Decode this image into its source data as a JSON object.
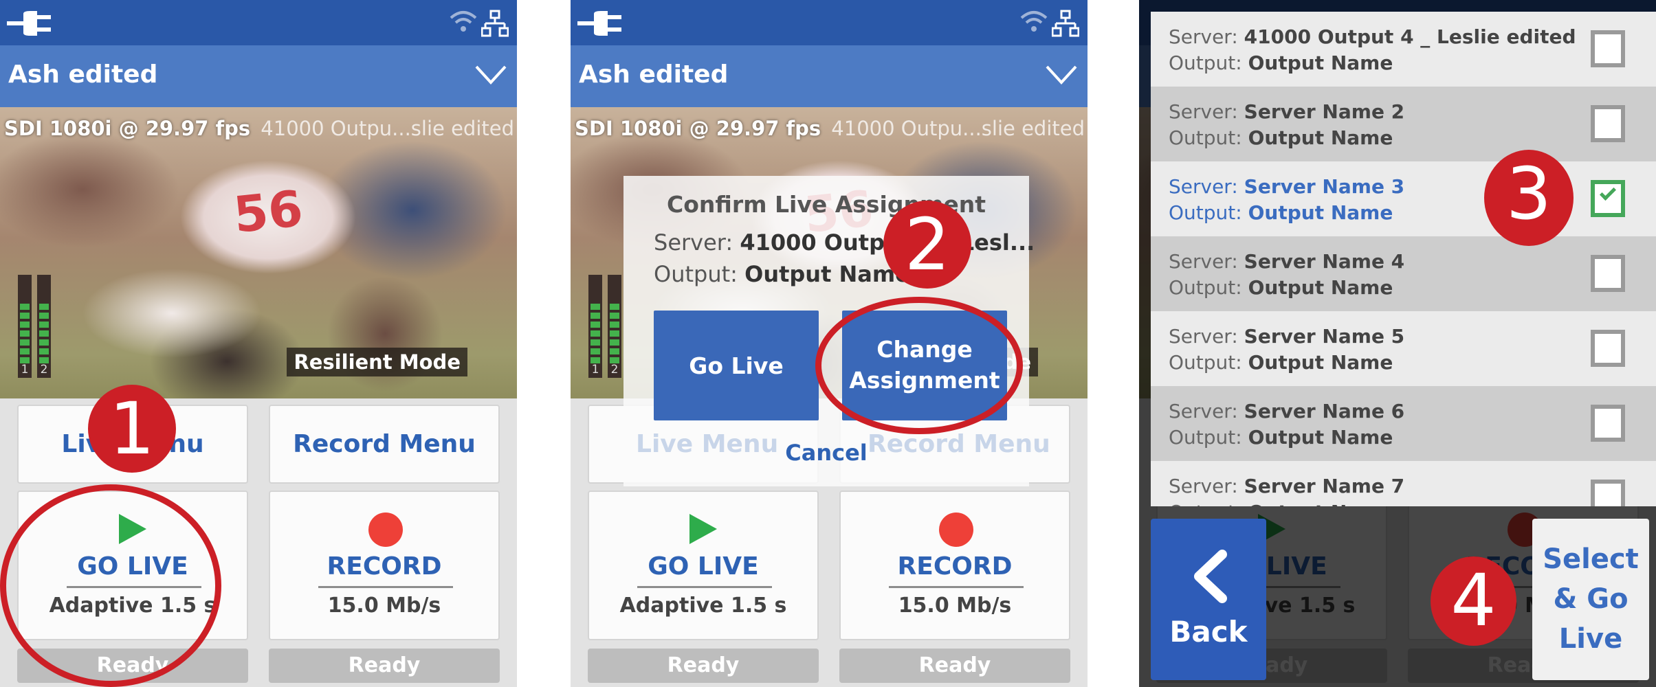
{
  "device": {
    "title": "Ash edited",
    "video_format": "SDI 1080i @ 29.97 fps",
    "server_short": "41000 Outpu...slie edited",
    "mode_badge": "Resilient Mode",
    "audio_channels": [
      "1",
      "2"
    ],
    "audio_level_segments": 7
  },
  "icons": {
    "power": "plug-icon",
    "wifi": "wifi-icon",
    "network": "network-icon",
    "expand": "chevron-down-icon",
    "go_live": "play-icon",
    "record": "record-dot-icon",
    "back": "chevron-left-icon",
    "check": "check-icon"
  },
  "controls": {
    "live_menu": "Live Menu",
    "record_menu": "Record Menu",
    "go_live": {
      "title": "GO LIVE",
      "subtitle": "Adaptive 1.5 s",
      "status": "Ready"
    },
    "record": {
      "title": "RECORD",
      "subtitle": "15.0 Mb/s",
      "status": "Ready"
    }
  },
  "steps": [
    "1",
    "2",
    "3",
    "4"
  ],
  "dialog": {
    "title": "Confirm Live Assignment",
    "server_label": "Server:",
    "server_value": "41000 Output 4 _ Lesl...",
    "output_label": "Output:",
    "output_value": "Output Name",
    "go_live": "Go Live",
    "change_assignment": "Change Assignment",
    "cancel": "Cancel"
  },
  "server_list": {
    "server_label": "Server:",
    "output_label": "Output:",
    "items": [
      {
        "server": "41000 Output 4 _ Leslie edited",
        "output": "Output Name",
        "checked": false
      },
      {
        "server": "Server Name 2",
        "output": "Output Name",
        "checked": false
      },
      {
        "server": "Server Name 3",
        "output": "Output Name",
        "checked": true
      },
      {
        "server": "Server Name 4",
        "output": "Output Name",
        "checked": false
      },
      {
        "server": "Server Name 5",
        "output": "Output Name",
        "checked": false
      },
      {
        "server": "Server Name 6",
        "output": "Output Name",
        "checked": false
      },
      {
        "server": "Server Name 7",
        "output": "Output Name",
        "checked": false
      }
    ],
    "back": "Back",
    "select_go_live": "Select\n& Go\nLive"
  },
  "colors": {
    "header_blue": "#2a58a8",
    "title_blue": "#4d7bc4",
    "accent_blue": "#2e62b4",
    "annotation_red": "#cc1f26",
    "play_green": "#2eac4b",
    "record_red": "#ee4038",
    "check_green": "#45a75a"
  }
}
